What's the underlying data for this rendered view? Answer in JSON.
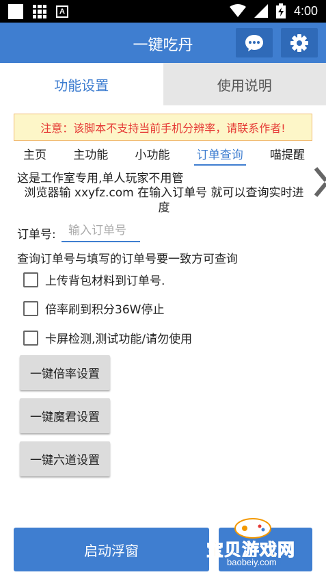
{
  "statusbar": {
    "time": "4:00",
    "notification_letter": "A"
  },
  "appbar": {
    "title": "一键吃丹"
  },
  "tabs": [
    {
      "label": "功能设置"
    },
    {
      "label": "使用说明"
    }
  ],
  "notice": "注意：该脚本不支持当前手机分辨率，请联系作者!",
  "subtabs": [
    {
      "label": "主页"
    },
    {
      "label": "主功能"
    },
    {
      "label": "小功能"
    },
    {
      "label": "订单查询"
    },
    {
      "label": "喵提醒"
    }
  ],
  "content": {
    "desc1": "这是工作室专用,单人玩家不用管",
    "desc2": "浏览器输 xxyfz.com  在输入订单号 就可以查询实时进度",
    "order_label": "订单号:",
    "order_placeholder": "输入订单号",
    "hint": "查询订单号与填写的订单号要一致方可查询",
    "checkboxes": [
      {
        "label": "上传背包材料到订单号."
      },
      {
        "label": "倍率刷到积分36W停止"
      },
      {
        "label": "卡屏检测,测试功能/请勿使用"
      }
    ],
    "buttons": [
      {
        "label": "一键倍率设置"
      },
      {
        "label": "一键魔君设置"
      },
      {
        "label": "一键六道设置"
      }
    ]
  },
  "bottom": {
    "start_label": "启动浮窗",
    "second_label": "..."
  },
  "watermark": {
    "text": "宝贝游戏网",
    "url": "baobeiy.com"
  },
  "colors": {
    "primary": "#3f7ed0",
    "notice_text": "#e53935",
    "notice_bg": "#fdf6c8"
  }
}
